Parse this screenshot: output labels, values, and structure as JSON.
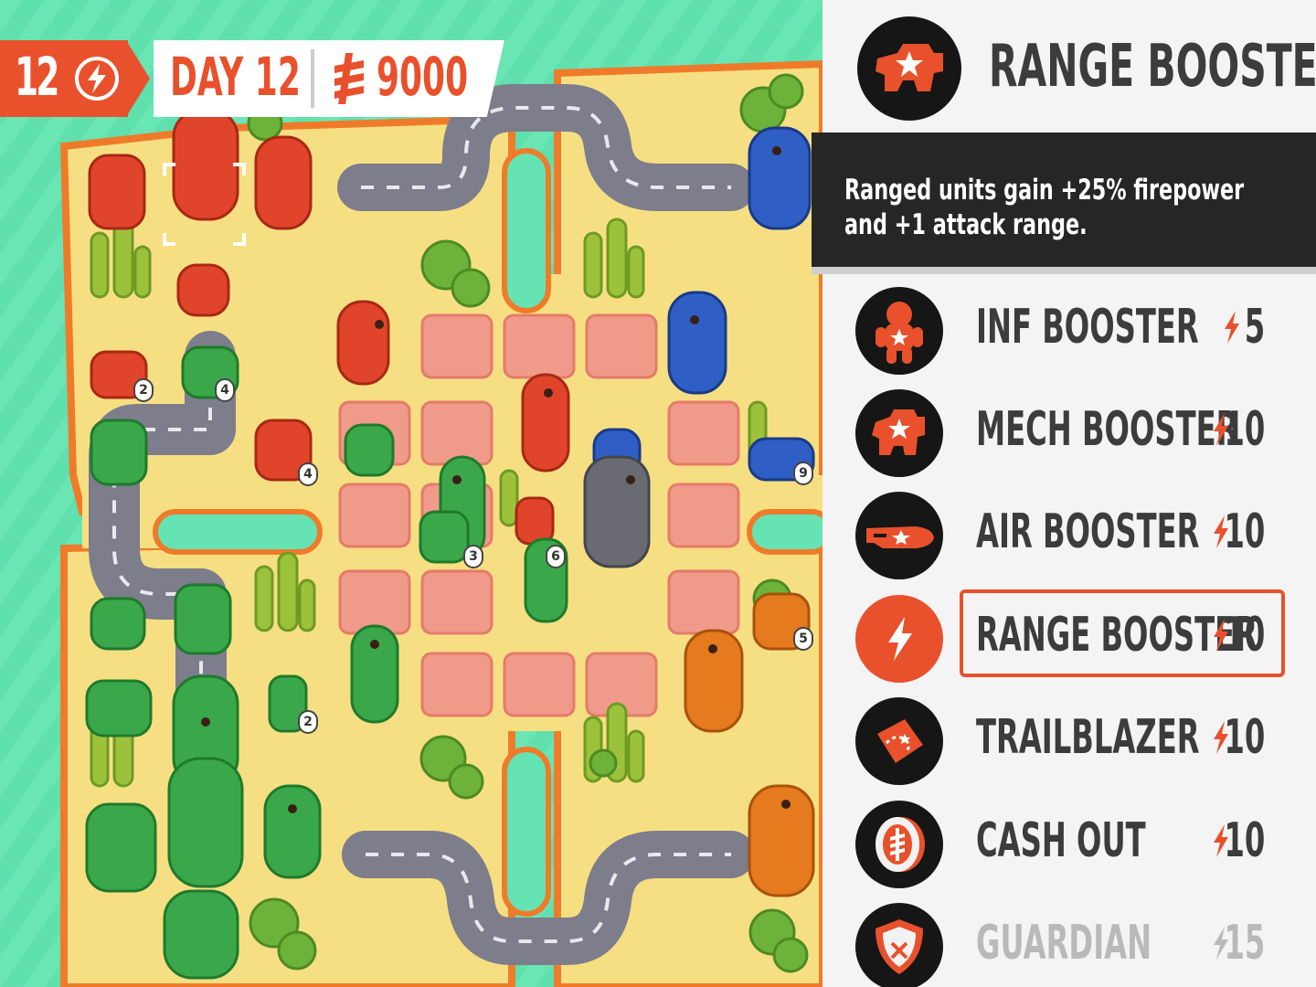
{
  "hud": {
    "energy": "12",
    "day": "DAY 12",
    "cash": "9000",
    "icons": [
      "energy-icon",
      "cash-icon"
    ]
  },
  "panel": {
    "title": "RANGE BOOSTER",
    "description": "Ranged units gain +25% firepower and +1 attack range.",
    "items": [
      {
        "label": "INF BOOSTER",
        "cost": "5",
        "icon": "infantry-icon"
      },
      {
        "label": "MECH BOOSTER",
        "cost": "10",
        "icon": "mech-icon"
      },
      {
        "label": "AIR BOOSTER",
        "cost": "10",
        "icon": "air-icon"
      },
      {
        "label": "RANGE BOOSTER",
        "cost": "10",
        "icon": "bolt-icon",
        "selected": true
      },
      {
        "label": "TRAILBLAZER",
        "cost": "10",
        "icon": "map-icon"
      },
      {
        "label": "CASH OUT",
        "cost": "10",
        "icon": "coin-icon"
      },
      {
        "label": "GUARDIAN",
        "cost": "15",
        "icon": "shield-icon",
        "disabled": true
      }
    ]
  },
  "map": {
    "unit_badges": [
      "2",
      "4",
      "4",
      "9",
      "3",
      "6",
      "5",
      "2"
    ]
  },
  "colors": {
    "accent": "#e8512c",
    "red_army": "#e0452c",
    "green_army": "#3aa84a",
    "blue_army": "#2f5fc4",
    "orange_army": "#e57a1e",
    "sand": "#f6df82",
    "water": "#66e3b3",
    "road": "#7d7d8c"
  }
}
